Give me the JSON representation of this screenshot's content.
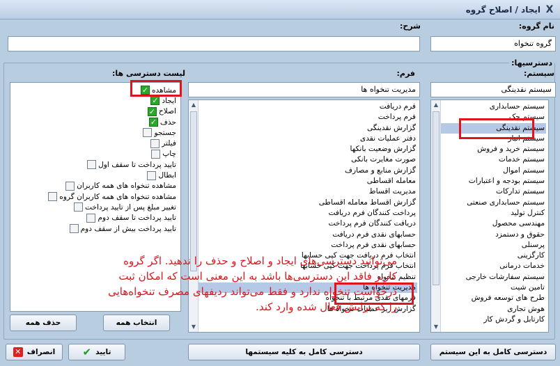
{
  "window": {
    "title": "ایجاد / اصلاح گروه",
    "close_glyph": "X"
  },
  "group_name": {
    "label": "نام گروه:",
    "value": "گروه تنخواه"
  },
  "description": {
    "label": "شرح:",
    "value": ""
  },
  "permissions_group": {
    "label": "دسترسیها:"
  },
  "systems": {
    "label": "سیستم:",
    "current": "سیستم نقدینگی",
    "items": [
      "سیستم حسابداری",
      "سیستم چک",
      "سیستم نقدینگی",
      "سیستم انبار",
      "سیستم خرید و فروش",
      "سیستم خدمات",
      "سیستم اموال",
      "سیستم بودجه و اعتبارات",
      "سیستم تدارکات",
      "سیستم حسابداری صنعتی",
      "کنترل تولید",
      "مهندسی محصول",
      "حقوق و دستمزد",
      "پرسنلی",
      "کارگزینی",
      "خدمات درمانی",
      "سیستم سفارشات خارجی",
      "تامین شیت",
      "طرح های توسعه فروش",
      "هوش تجاری",
      "کارتابل و گردش کار"
    ],
    "selected_index": 2
  },
  "forms": {
    "label": "فرم:",
    "current": "مدیریت تنخواه ها",
    "items": [
      "فرم دریافت",
      "فرم پرداخت",
      "گزارش نقدینگی",
      "دفتر عملیات نقدی",
      "گزارش وضعیت بانکها",
      "صورت مغایرت بانکی",
      "گزارش منابع و مصارف",
      "معامله اقساطی",
      "مدیریت اقساط",
      "گزارش اقساط معامله اقساطی",
      "پرداخت کنندگان فرم دریافت",
      "دریافت کنندگان فرم پرداخت",
      "حسابهای نقدی فرم دریافت",
      "حسابهای نقدی فرم پرداخت",
      "انتخاب فرم دریافت جهت کپی حسابها",
      "انتخاب فرم پرداخت جهت کپی حسابها",
      "تنظیم تنخواه",
      "مدیریت تنخواه ها",
      "فرمهای نقدی مرتبط با تنخواه",
      "گزارش ریز عملیات تنخواه ها"
    ],
    "selected_index": 17
  },
  "permissions": {
    "label": "لیست دسترسی ها:",
    "items": [
      {
        "label": "مشاهده",
        "checked": true
      },
      {
        "label": "ایجاد",
        "checked": true
      },
      {
        "label": "اصلاح",
        "checked": true
      },
      {
        "label": "حذف",
        "checked": true
      },
      {
        "label": "جستجو",
        "checked": false
      },
      {
        "label": "فیلتر",
        "checked": false
      },
      {
        "label": "چاپ",
        "checked": false
      },
      {
        "label": "تایید پرداخت تا سقف اول",
        "checked": false
      },
      {
        "label": "ابطال",
        "checked": false
      },
      {
        "label": "مشاهده تنخواه های همه کاربران",
        "checked": false
      },
      {
        "label": "مشاهده تنخواه های همه کاربران گروه",
        "checked": false
      },
      {
        "label": "تغییر مبلغ پس از تایید پرداخت",
        "checked": false
      },
      {
        "label": "تایید پرداخت تا سقف دوم",
        "checked": false
      },
      {
        "label": "تایید پرداخت بیش از سقف دوم",
        "checked": false
      }
    ]
  },
  "annotation": "می‌توانید دسترسی‌های ایجاد و اصلاح و حذف را ندهید. اگر گروه کاربر فاقد این دسترسی‌ها باشد به این معنی است که امکان ثبت درخواست تنخواه ندارد و فقط می‌تواند ردیفهای مصرف تنخواه‌هایی را که برایش فعال شده وارد کند.",
  "buttons": {
    "select_all": "انتخاب همه",
    "deselect_all": "حذف همه",
    "full_access_system": "دسترسی کامل به این سیستم",
    "full_access_all": "دسترسی کامل به کلیه سیستمها",
    "ok": "تایید",
    "cancel": "انصراف"
  },
  "colors": {
    "highlight_border": "#e0141c",
    "check_green": "#2aa82a",
    "selection": "#b5c9e6"
  }
}
